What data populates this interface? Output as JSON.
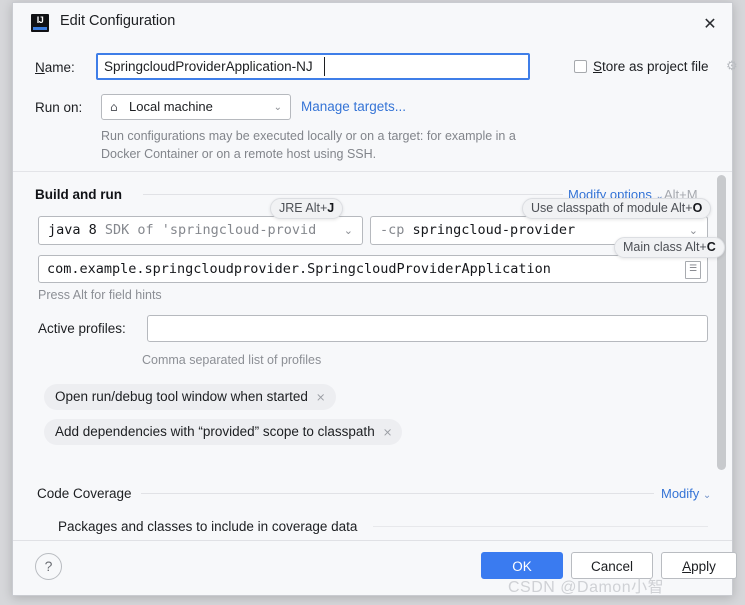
{
  "window": {
    "title": "Edit Configuration",
    "logo_text": "IJ",
    "close_icon": "✕"
  },
  "name_row": {
    "label_prefix": "N",
    "label_rest": "ame:",
    "value": "SpringcloudProviderApplication-NJ",
    "store_checkbox_prefix": "S",
    "store_checkbox_rest": "tore as project file",
    "store_gear_icon": "⚙"
  },
  "run_on": {
    "label": "Run on:",
    "selected": "Local machine",
    "home_icon": "⌂",
    "arrow_icon": "⌄",
    "manage_targets": "Manage targets...",
    "description": "Run configurations may be executed locally or on a target: for example in a Docker Container or on a remote host using SSH."
  },
  "build_and_run": {
    "title": "Build and run",
    "modify_options": "Modify options",
    "modify_chevron": "⌄",
    "modify_shortcut": "Alt+M",
    "tooltips": {
      "jre": {
        "text": "JRE Alt+",
        "key": "J"
      },
      "classpath": {
        "text": "Use classpath of module Alt+",
        "key": "O"
      },
      "main_class": {
        "text": "Main class Alt+",
        "key": "C"
      }
    },
    "jre": {
      "strong": "java 8",
      "dim": " SDK of 'springcloud-provid",
      "arrow_icon": "⌄"
    },
    "classpath": {
      "dim": "-cp",
      "strong": " springcloud-provider",
      "arrow_icon": "⌄"
    },
    "main_class": {
      "value": "com.example.springcloudprovider.SpringcloudProviderApplication",
      "browse_icon": "☰"
    },
    "hints": "Press Alt for field hints"
  },
  "active_profiles": {
    "label": "Active profiles:",
    "value": "",
    "placeholder": "",
    "hint": "Comma separated list of profiles"
  },
  "chips": [
    {
      "label": "Open run/debug tool window when started",
      "close_icon": "×"
    },
    {
      "label": "Add dependencies with “provided” scope to classpath",
      "close_icon": "×"
    }
  ],
  "code_coverage": {
    "title": "Code Coverage",
    "modify": "Modify",
    "modify_chevron": "⌄",
    "packages_label": "Packages and classes to include in coverage data",
    "packages_value": ""
  },
  "footer": {
    "help_icon": "?",
    "ok": "OK",
    "cancel": "Cancel",
    "apply_prefix": "A",
    "apply_rest": "pply"
  },
  "watermark": "CSDN @Damon小智",
  "colors": {
    "accent_blue": "#3a7bf0",
    "link_blue": "#3574d6",
    "dialog_bg": "#f7f8fa",
    "focus_border": "#3f7ee8"
  }
}
